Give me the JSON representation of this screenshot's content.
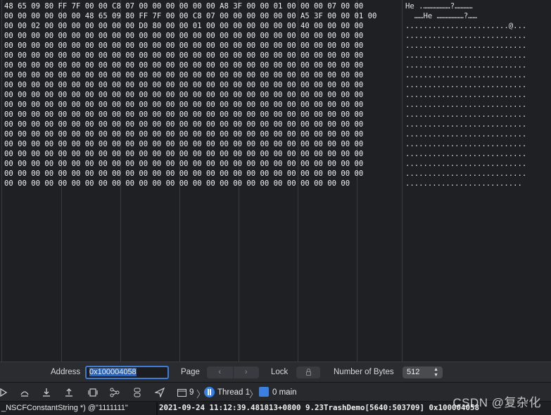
{
  "memory": {
    "hex_rows": [
      "48 65 09 80 FF 7F 00 00 C8 07 00 00 00 00 00 00 A8 3F 00 00 01 00 00 00 07 00 00",
      "00 00 00 00 00 00 48 65 09 80 FF 7F 00 00 C8 07 00 00 00 00 00 00 A5 3F 00 00 01 00",
      "00 00 02 00 00 00 00 00 00 00 D0 80 00 00 01 00 00 00 00 00 00 00 40 00 00 00 00",
      "00 00 00 00 00 00 00 00 00 00 00 00 00 00 00 00 00 00 00 00 00 00 00 00 00 00 00",
      "00 00 00 00 00 00 00 00 00 00 00 00 00 00 00 00 00 00 00 00 00 00 00 00 00 00 00",
      "00 00 00 00 00 00 00 00 00 00 00 00 00 00 00 00 00 00 00 00 00 00 00 00 00 00 00",
      "00 00 00 00 00 00 00 00 00 00 00 00 00 00 00 00 00 00 00 00 00 00 00 00 00 00 00",
      "00 00 00 00 00 00 00 00 00 00 00 00 00 00 00 00 00 00 00 00 00 00 00 00 00 00 00",
      "00 00 00 00 00 00 00 00 00 00 00 00 00 00 00 00 00 00 00 00 00 00 00 00 00 00 00",
      "00 00 00 00 00 00 00 00 00 00 00 00 00 00 00 00 00 00 00 00 00 00 00 00 00 00 00",
      "00 00 00 00 00 00 00 00 00 00 00 00 00 00 00 00 00 00 00 00 00 00 00 00 00 00 00",
      "00 00 00 00 00 00 00 00 00 00 00 00 00 00 00 00 00 00 00 00 00 00 00 00 00 00 00",
      "00 00 00 00 00 00 00 00 00 00 00 00 00 00 00 00 00 00 00 00 00 00 00 00 00 00 00",
      "00 00 00 00 00 00 00 00 00 00 00 00 00 00 00 00 00 00 00 00 00 00 00 00 00 00 00",
      "00 00 00 00 00 00 00 00 00 00 00 00 00 00 00 00 00 00 00 00 00 00 00 00 00 00 00",
      "00 00 00 00 00 00 00 00 00 00 00 00 00 00 00 00 00 00 00 00 00 00 00 00 00 00 00",
      "00 00 00 00 00 00 00 00 00 00 00 00 00 00 00 00 00 00 00 00 00 00 00 00 00 00 00",
      "00 00 00 00 00 00 00 00 00 00 00 00 00 00 00 00 00 00 00 00 00 00 00 00 00 00 00",
      "00 00 00 00 00 00 00 00 00 00 00 00 00 00 00 00 00 00 00 00 00 00 00 00 00 00"
    ],
    "ascii_rows": [
      "He .………………?…………",
      "  ……He ………………?……",
      ".......................@...",
      "...........................",
      "...........................",
      "...........................",
      "...........................",
      "...........................",
      "...........................",
      "...........................",
      "...........................",
      "...........................",
      "...........................",
      "...........................",
      "...........................",
      "...........................",
      "...........................",
      "...........................",
      ".........................."
    ]
  },
  "address_bar": {
    "address_label": "Address",
    "address_value": "0x100004058",
    "page_label": "Page",
    "page_prev": "‹",
    "page_next": "›",
    "lock_label": "Lock",
    "bytes_label": "Number of Bytes",
    "bytes_value": "512"
  },
  "debug_bar": {
    "frame_count": "9",
    "thread_label": "Thread 1",
    "frame_label": "0 main"
  },
  "variables": {
    "text": "_NSCFConstantString *) @\"1111111\""
  },
  "console": {
    "text": "2021-09-24 11:12:39.481813+0800 9.23TrashDemo[5640:503709] 0x100004058"
  },
  "watermark": {
    "text": "CSDN @复杂化"
  },
  "colors": {
    "accent": "#3b7fe0",
    "selection": "#2d63b5",
    "background": "#1f2024"
  }
}
